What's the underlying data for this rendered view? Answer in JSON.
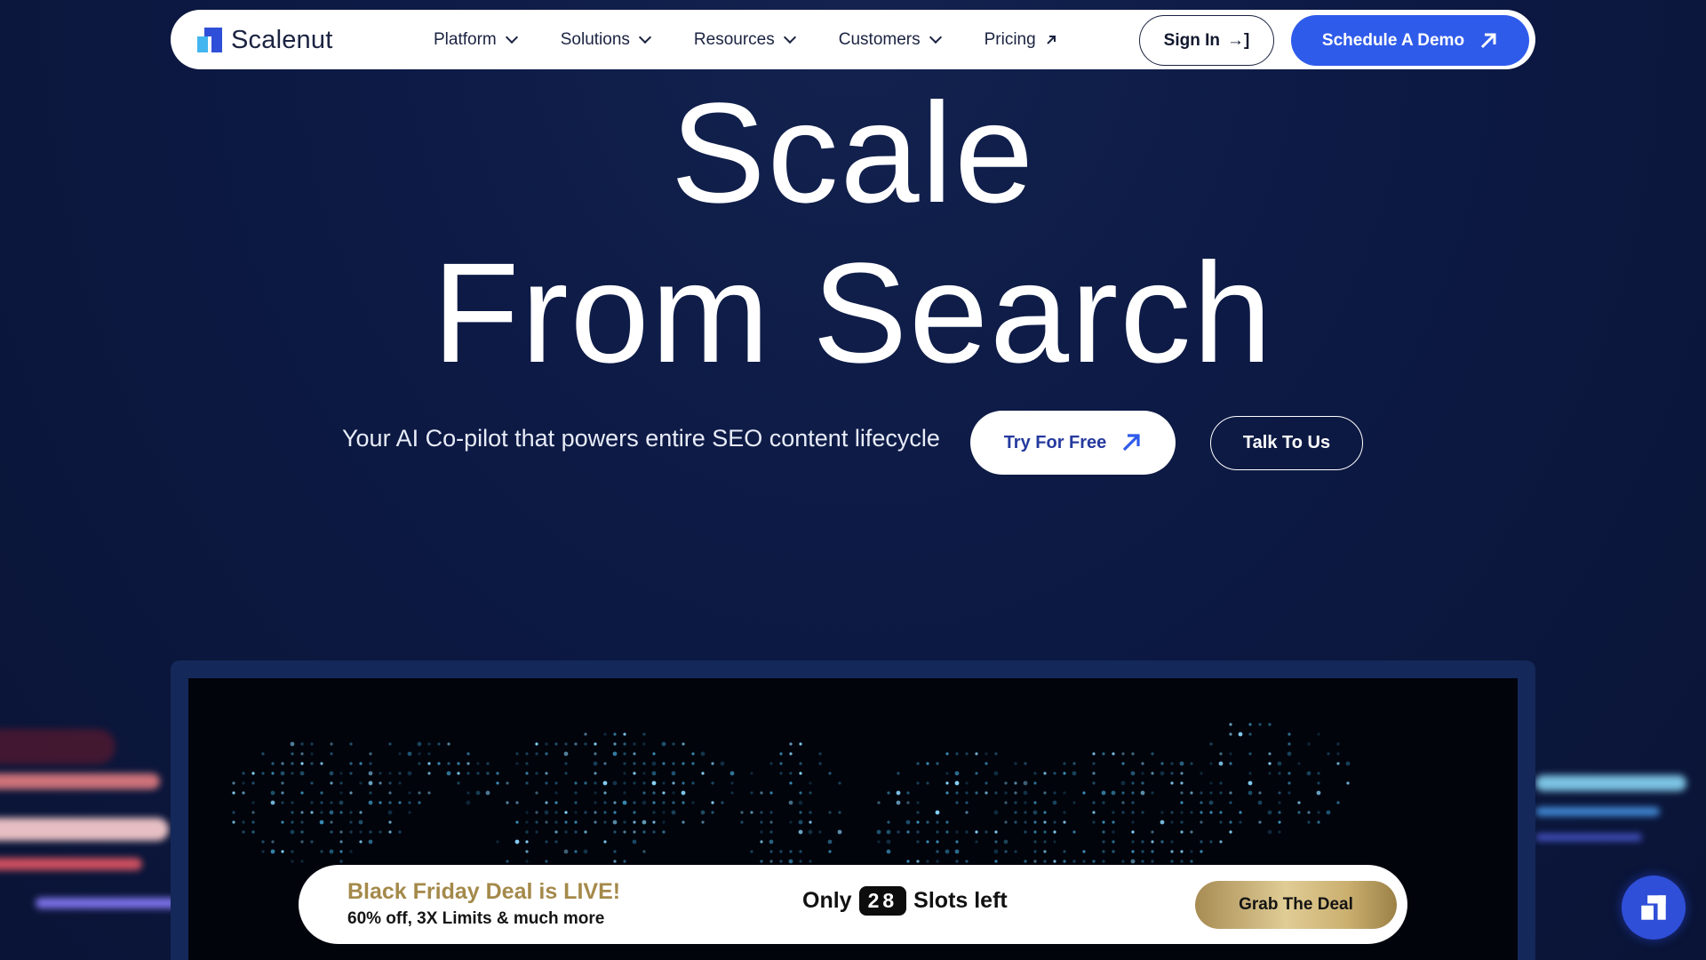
{
  "brand": {
    "name": "Scalenut",
    "colors": {
      "primary": "#2f5bea",
      "navy": "#0d1a45",
      "gold": "#a4894a"
    }
  },
  "nav": {
    "items": [
      {
        "label": "Platform",
        "icon": "chevron-down-icon"
      },
      {
        "label": "Solutions",
        "icon": "chevron-down-icon"
      },
      {
        "label": "Resources",
        "icon": "chevron-down-icon"
      },
      {
        "label": "Customers",
        "icon": "chevron-down-icon"
      },
      {
        "label": "Pricing",
        "icon": "external-arrow-icon"
      }
    ],
    "signin_label": "Sign In",
    "signin_icon": "→]",
    "demo_label": "Schedule A Demo"
  },
  "hero": {
    "title_line1": "Scale",
    "title_line2": "From Search",
    "subtitle": "Your AI Co-pilot that powers entire SEO content lifecycle",
    "try_label": "Try For Free",
    "talk_label": "Talk To Us"
  },
  "deal": {
    "title": "Black Friday Deal is LIVE!",
    "subtitle": "60% off, 3X Limits & much more",
    "slots_prefix": "Only",
    "slots_count": "28",
    "slots_suffix": "Slots left",
    "button_label": "Grab The Deal"
  },
  "chat": {
    "icon": "scalenut-logo-icon"
  }
}
